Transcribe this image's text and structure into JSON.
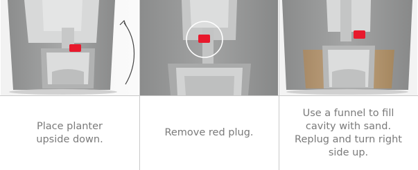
{
  "steps": [
    {
      "caption": "Place planter\nupside down."
    },
    {
      "caption": "Remove red plug."
    },
    {
      "caption": "Use a funnel to fill\ncavity with sand.\nReplug and turn right\nside up."
    }
  ],
  "colors": {
    "planter_gray": "#9a9b9b",
    "cavity": "#d7d8d8",
    "plug_red": "#e8192c",
    "sand": "#b69a78",
    "divider": "#c9c9c9",
    "text": "#7a7a7a"
  }
}
